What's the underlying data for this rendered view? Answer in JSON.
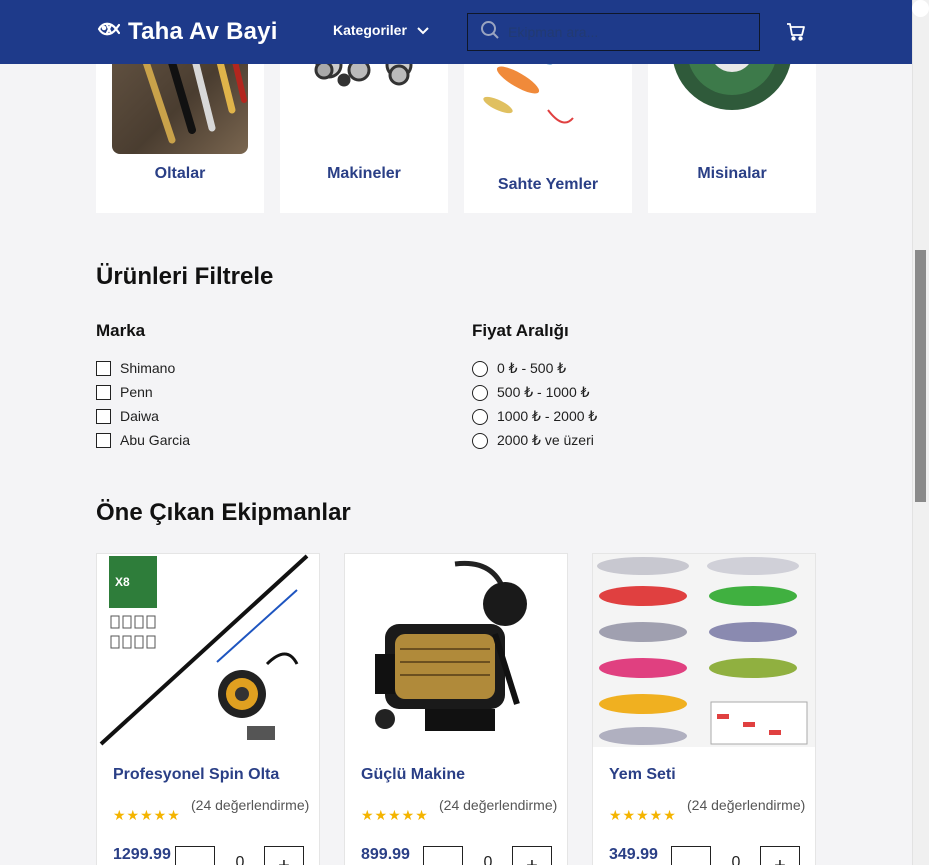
{
  "header": {
    "brand": "Taha Av Bayi",
    "nav_categories": "Kategoriler",
    "search_placeholder": "Ekipman ara..."
  },
  "categories": [
    {
      "label": "Oltalar"
    },
    {
      "label": "Makineler"
    },
    {
      "label": "Sahte Yemler"
    },
    {
      "label": "Misinalar"
    }
  ],
  "filters": {
    "title": "Ürünleri Filtrele",
    "brand_heading": "Marka",
    "brands": [
      "Shimano",
      "Penn",
      "Daiwa",
      "Abu Garcia"
    ],
    "price_heading": "Fiyat Aralığı",
    "price_ranges": [
      "0 ₺ - 500 ₺",
      "500 ₺ - 1000 ₺",
      "1000 ₺ - 2000 ₺",
      "2000 ₺ ve üzeri"
    ]
  },
  "featured": {
    "title": "Öne Çıkan Ekipmanlar",
    "products": [
      {
        "name": "Profesyonel Spin Olta",
        "stars": "★★★★★",
        "reviews": "(24 değerlendirme)",
        "price": "1299.99",
        "qty": "0",
        "plus": "+"
      },
      {
        "name": "Güçlü Makine",
        "stars": "★★★★★",
        "reviews": "(24 değerlendirme)",
        "price": "899.99",
        "qty": "0",
        "plus": "+"
      },
      {
        "name": "Yem Seti",
        "stars": "★★★★★",
        "reviews": "(24 değerlendirme)",
        "price": "349.99",
        "qty": "0",
        "plus": "+"
      }
    ]
  },
  "colors": {
    "header_bg": "#1e3a8a",
    "accent_text": "#2a3f86",
    "star": "#f4b400"
  }
}
